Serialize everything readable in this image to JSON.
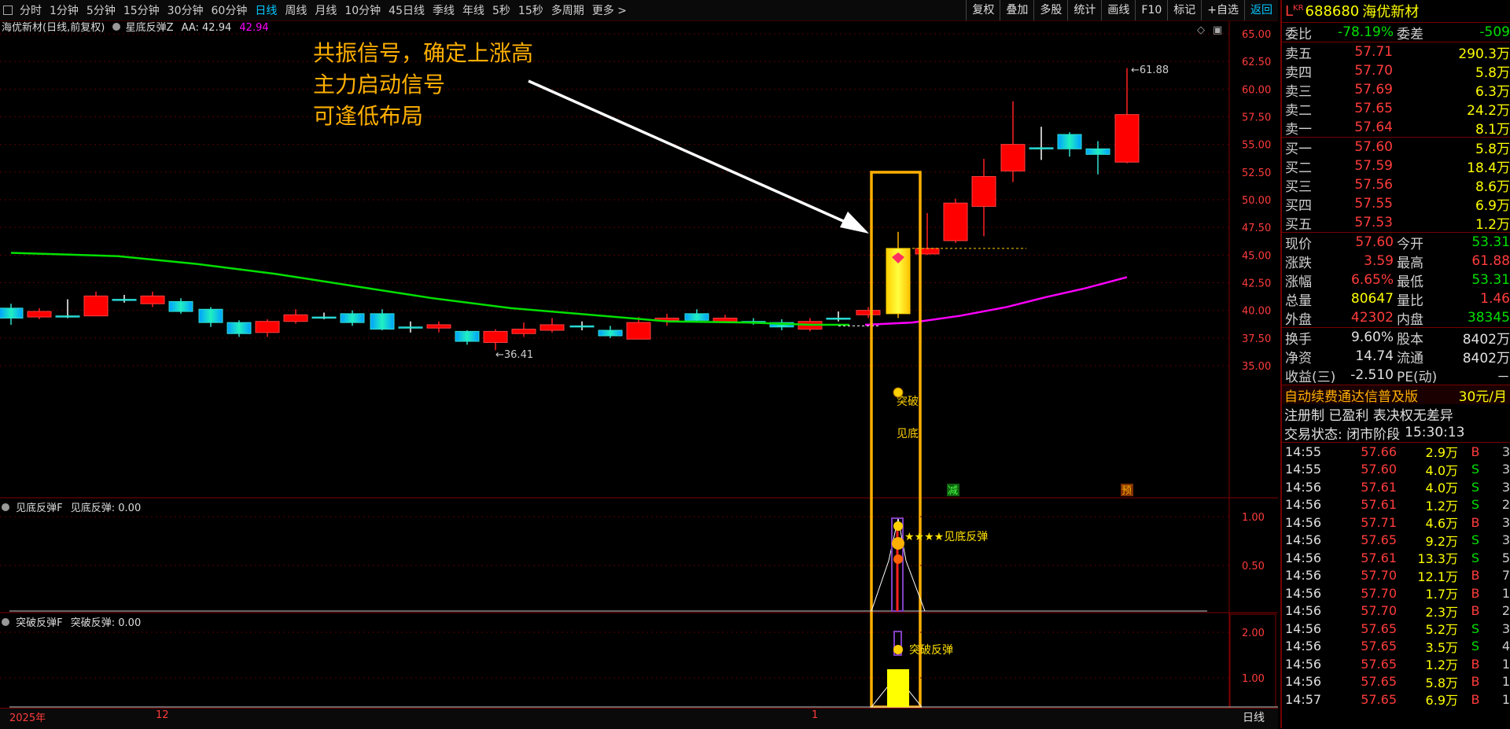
{
  "toolbar": {
    "periods": [
      "分时",
      "1分钟",
      "5分钟",
      "15分钟",
      "30分钟",
      "60分钟",
      "日线",
      "周线",
      "月线",
      "10分钟",
      "45日线",
      "季线",
      "年线",
      "5秒",
      "15秒",
      "多周期",
      "更多 >"
    ],
    "active_period": "日线",
    "right_buttons": [
      "复权",
      "叠加",
      "多股",
      "统计",
      "画线",
      "F10",
      "标记",
      "+自选",
      "返回"
    ]
  },
  "main_chart": {
    "stock_title": "海优新材(日线,前复权)",
    "indicator_name": "星底反弹Z",
    "aa_label": "AA: 42.94",
    "aa_value2": "42.94",
    "y_ticks": [
      "65.00",
      "62.50",
      "60.00",
      "57.50",
      "55.00",
      "52.50",
      "50.00",
      "47.50",
      "45.00",
      "42.50",
      "40.00",
      "37.50",
      "35.00"
    ],
    "high_label": "61.88",
    "low_label": "36.41",
    "signal_labels": {
      "tupo": "突破",
      "jiandi": "见底",
      "jian": "减",
      "yu": "预"
    },
    "annotation": [
      "共振信号，确定上涨高",
      "主力启动信号",
      "可逢低布局"
    ],
    "colors": {
      "up": "#ff0000",
      "down_grad": "#00e0c0",
      "ma_green": "#00e000",
      "ma_magenta": "#ff00ff",
      "box": "#ffb000",
      "grid": "#700000"
    }
  },
  "chart_data": {
    "type": "candlestick",
    "ylim": [
      33,
      66
    ],
    "candles": [
      {
        "o": 40.2,
        "c": 39.3,
        "h": 40.6,
        "l": 38.7
      },
      {
        "o": 39.4,
        "c": 39.9,
        "h": 40.2,
        "l": 39.2
      },
      {
        "o": 39.5,
        "c": 39.5,
        "h": 41.0,
        "l": 39.3
      },
      {
        "o": 39.5,
        "c": 41.3,
        "h": 41.7,
        "l": 39.5
      },
      {
        "o": 41.0,
        "c": 41.0,
        "h": 41.4,
        "l": 40.7
      },
      {
        "o": 40.6,
        "c": 41.3,
        "h": 41.7,
        "l": 40.3
      },
      {
        "o": 40.8,
        "c": 39.9,
        "h": 41.1,
        "l": 39.7
      },
      {
        "o": 40.1,
        "c": 38.9,
        "h": 40.3,
        "l": 38.5
      },
      {
        "o": 38.9,
        "c": 37.9,
        "h": 39.1,
        "l": 37.6
      },
      {
        "o": 38.0,
        "c": 39.0,
        "h": 39.2,
        "l": 37.6
      },
      {
        "o": 39.0,
        "c": 39.6,
        "h": 40.1,
        "l": 38.8
      },
      {
        "o": 39.4,
        "c": 39.4,
        "h": 39.8,
        "l": 39.2
      },
      {
        "o": 39.7,
        "c": 38.9,
        "h": 40.0,
        "l": 38.6
      },
      {
        "o": 39.7,
        "c": 38.3,
        "h": 40.1,
        "l": 38.2
      },
      {
        "o": 38.5,
        "c": 38.5,
        "h": 39.0,
        "l": 38.0
      },
      {
        "o": 38.4,
        "c": 38.7,
        "h": 39.0,
        "l": 38.0
      },
      {
        "o": 38.1,
        "c": 37.2,
        "h": 38.2,
        "l": 36.9
      },
      {
        "o": 37.1,
        "c": 38.1,
        "h": 38.3,
        "l": 36.4
      },
      {
        "o": 37.9,
        "c": 38.3,
        "h": 38.9,
        "l": 37.6
      },
      {
        "o": 38.2,
        "c": 38.7,
        "h": 39.3,
        "l": 38.0
      },
      {
        "o": 38.6,
        "c": 38.6,
        "h": 39.0,
        "l": 38.2
      },
      {
        "o": 38.2,
        "c": 37.7,
        "h": 38.6,
        "l": 37.5
      },
      {
        "o": 37.4,
        "c": 38.9,
        "h": 39.4,
        "l": 37.4
      },
      {
        "o": 39.1,
        "c": 39.3,
        "h": 39.7,
        "l": 38.6
      },
      {
        "o": 39.7,
        "c": 39.1,
        "h": 40.1,
        "l": 38.9
      },
      {
        "o": 39.0,
        "c": 39.3,
        "h": 39.6,
        "l": 38.9
      },
      {
        "o": 39.0,
        "c": 38.9,
        "h": 39.3,
        "l": 38.7
      },
      {
        "o": 38.9,
        "c": 38.5,
        "h": 39.2,
        "l": 38.2
      },
      {
        "o": 38.3,
        "c": 39.0,
        "h": 39.3,
        "l": 38.1
      },
      {
        "o": 39.3,
        "c": 39.3,
        "h": 39.9,
        "l": 39.0
      },
      {
        "o": 39.6,
        "c": 40.0,
        "h": 40.3,
        "l": 39.3
      },
      {
        "o": 39.7,
        "c": 45.6,
        "h": 47.1,
        "l": 39.3
      },
      {
        "o": 45.1,
        "c": 45.6,
        "h": 48.8,
        "l": 45.0
      },
      {
        "o": 46.3,
        "c": 49.7,
        "h": 50.1,
        "l": 46.1
      },
      {
        "o": 49.4,
        "c": 52.1,
        "h": 53.7,
        "l": 46.7
      },
      {
        "o": 52.6,
        "c": 55.0,
        "h": 58.9,
        "l": 51.6
      },
      {
        "o": 54.7,
        "c": 54.7,
        "h": 56.6,
        "l": 53.6
      },
      {
        "o": 55.9,
        "c": 54.6,
        "h": 56.1,
        "l": 53.9
      },
      {
        "o": 54.6,
        "c": 54.1,
        "h": 55.3,
        "l": 52.3
      },
      {
        "o": 53.4,
        "c": 57.7,
        "h": 61.9,
        "l": 53.3
      }
    ]
  },
  "sub1": {
    "title": "见底反弹F",
    "value_label": "见底反弹: 0.00",
    "y_ticks": [
      "1.00",
      "0.50"
    ],
    "signal_label": "★★★★见底反弹"
  },
  "sub2": {
    "title": "突破反弹F",
    "value_label": "突破反弹: 0.00",
    "y_ticks": [
      "2.00",
      "1.00"
    ],
    "signal_label": "突破反弹"
  },
  "time_axis": {
    "labels": [
      "2025年",
      "12",
      "1"
    ],
    "right_label": "日线"
  },
  "quote": {
    "code": "688680",
    "name": "海优新材",
    "tag": "L",
    "tag_sup": "KR",
    "weibi": {
      "label": "委比",
      "value": "-78.19%",
      "label2": "委差",
      "value2": "-509"
    },
    "sells": [
      {
        "label": "卖五",
        "price": "57.71",
        "vol": "290.3万"
      },
      {
        "label": "卖四",
        "price": "57.70",
        "vol": "5.8万"
      },
      {
        "label": "卖三",
        "price": "57.69",
        "vol": "6.3万"
      },
      {
        "label": "卖二",
        "price": "57.65",
        "vol": "24.2万"
      },
      {
        "label": "卖一",
        "price": "57.64",
        "vol": "8.1万"
      }
    ],
    "buys": [
      {
        "label": "买一",
        "price": "57.60",
        "vol": "5.8万"
      },
      {
        "label": "买二",
        "price": "57.59",
        "vol": "18.4万"
      },
      {
        "label": "买三",
        "price": "57.56",
        "vol": "8.6万"
      },
      {
        "label": "买四",
        "price": "57.55",
        "vol": "6.9万"
      },
      {
        "label": "买五",
        "price": "57.53",
        "vol": "1.2万"
      }
    ],
    "stats1": [
      {
        "l1": "现价",
        "v1": "57.60",
        "c1": "red",
        "l2": "今开",
        "v2": "53.31",
        "c2": "green"
      },
      {
        "l1": "涨跌",
        "v1": "3.59",
        "c1": "red",
        "l2": "最高",
        "v2": "61.88",
        "c2": "red"
      },
      {
        "l1": "涨幅",
        "v1": "6.65%",
        "c1": "red",
        "l2": "最低",
        "v2": "53.31",
        "c2": "green"
      },
      {
        "l1": "总量",
        "v1": "80647",
        "c1": "yellow",
        "l2": "量比",
        "v2": "1.46",
        "c2": "red"
      },
      {
        "l1": "外盘",
        "v1": "42302",
        "c1": "red",
        "l2": "内盘",
        "v2": "38345",
        "c2": "green"
      }
    ],
    "stats2": [
      {
        "l1": "换手",
        "v1": "9.60%",
        "c1": "white",
        "l2": "股本",
        "v2": "8402万",
        "c2": "white"
      },
      {
        "l1": "净资",
        "v1": "14.74",
        "c1": "white",
        "l2": "流通",
        "v2": "8402万",
        "c2": "white"
      },
      {
        "l1": "收益(三)",
        "v1": "-2.510",
        "c1": "white",
        "l2": "PE(动)",
        "v2": "－",
        "c2": "white"
      }
    ],
    "promo": "自动续费通达信普及版",
    "promo_price": "30元/月",
    "reg_line": "注册制 已盈利 表决权无差异",
    "status_line": "交易状态: 闭市阶段",
    "status_time": "15:30:13"
  },
  "trades": [
    {
      "t": "14:55",
      "p": "57.66",
      "v": "2.9万",
      "f": "B",
      "n": "3"
    },
    {
      "t": "14:55",
      "p": "57.60",
      "v": "4.0万",
      "f": "S",
      "n": "3"
    },
    {
      "t": "14:56",
      "p": "57.61",
      "v": "4.0万",
      "f": "S",
      "n": "3"
    },
    {
      "t": "14:56",
      "p": "57.61",
      "v": "1.2万",
      "f": "S",
      "n": "2"
    },
    {
      "t": "14:56",
      "p": "57.71",
      "v": "4.6万",
      "f": "B",
      "n": "3"
    },
    {
      "t": "14:56",
      "p": "57.65",
      "v": "9.2万",
      "f": "S",
      "n": "3"
    },
    {
      "t": "14:56",
      "p": "57.61",
      "v": "13.3万",
      "f": "S",
      "n": "5"
    },
    {
      "t": "14:56",
      "p": "57.70",
      "v": "12.1万",
      "f": "B",
      "n": "7"
    },
    {
      "t": "14:56",
      "p": "57.70",
      "v": "1.7万",
      "f": "B",
      "n": "1"
    },
    {
      "t": "14:56",
      "p": "57.70",
      "v": "2.3万",
      "f": "B",
      "n": "2"
    },
    {
      "t": "14:56",
      "p": "57.65",
      "v": "5.2万",
      "f": "S",
      "n": "3"
    },
    {
      "t": "14:56",
      "p": "57.65",
      "v": "3.5万",
      "f": "S",
      "n": "4"
    },
    {
      "t": "14:56",
      "p": "57.65",
      "v": "1.2万",
      "f": "B",
      "n": "1"
    },
    {
      "t": "14:56",
      "p": "57.65",
      "v": "5.8万",
      "f": "B",
      "n": "1"
    },
    {
      "t": "14:57",
      "p": "57.65",
      "v": "6.9万",
      "f": "B",
      "n": "1"
    }
  ]
}
